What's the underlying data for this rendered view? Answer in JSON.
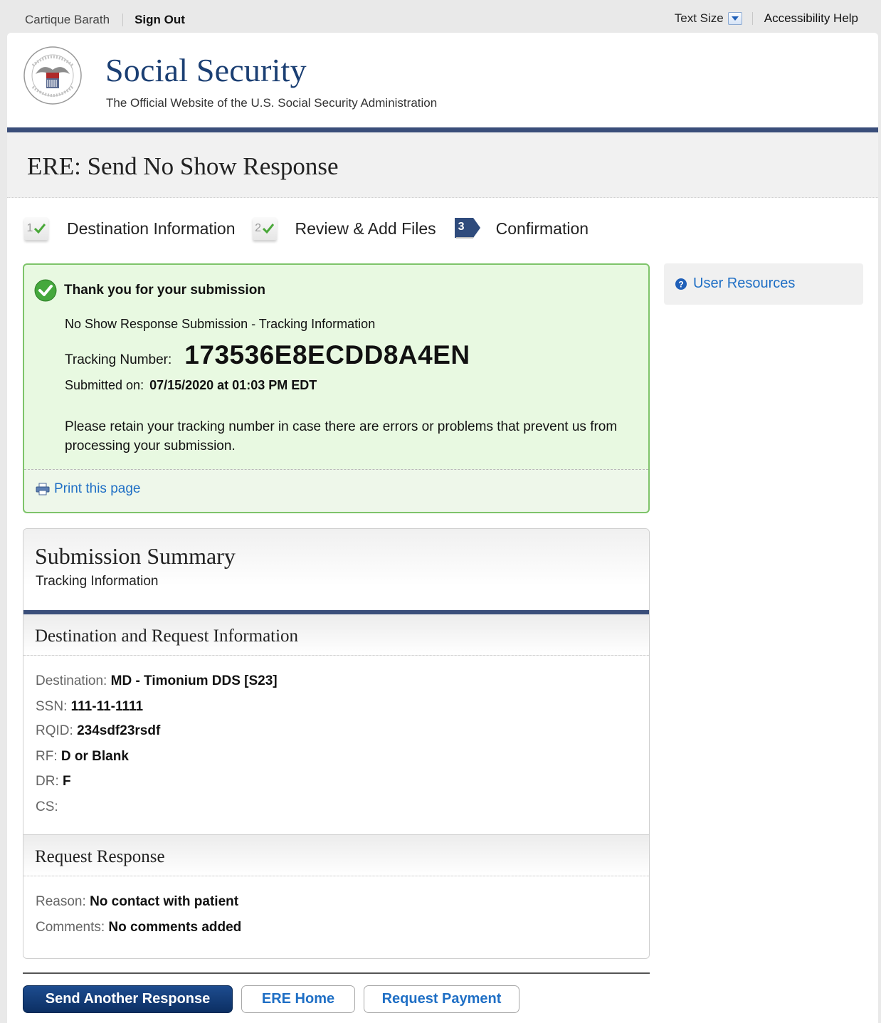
{
  "utility": {
    "user_name": "Cartique Barath",
    "sign_out": "Sign Out",
    "text_size": "Text Size",
    "accessibility_help": "Accessibility Help"
  },
  "header": {
    "title": "Social Security",
    "subtitle": "The Official Website of the U.S. Social Security Administration"
  },
  "page_title": "ERE: Send No Show Response",
  "steps": [
    {
      "num": "1",
      "label": "Destination Information",
      "state": "complete"
    },
    {
      "num": "2",
      "label": "Review & Add Files",
      "state": "complete"
    },
    {
      "num": "3",
      "label": "Confirmation",
      "state": "current"
    }
  ],
  "confirmation": {
    "title": "Thank you for your submission",
    "tracking_heading": "No Show Response Submission - Tracking Information",
    "tracking_label": "Tracking Number:",
    "tracking_number": "173536E8ECDD8A4EN",
    "submitted_label": "Submitted on:",
    "submitted_value": "07/15/2020 at 01:03 PM EDT",
    "message": "Please retain your tracking number in case there are errors or problems that prevent us from processing your submission.",
    "print_link": "Print this page"
  },
  "side": {
    "user_resources": "User Resources"
  },
  "summary": {
    "title": "Submission Summary",
    "subtitle": "Tracking Information",
    "destination_section": {
      "title": "Destination and Request Information",
      "fields": [
        {
          "label": "Destination:",
          "value": "MD - Timonium DDS [S23]"
        },
        {
          "label": "SSN:",
          "value": "111-11-1111"
        },
        {
          "label": "RQID:",
          "value": "234sdf23rsdf"
        },
        {
          "label": "RF:",
          "value": "D or Blank"
        },
        {
          "label": "DR:",
          "value": "F"
        },
        {
          "label": "CS:",
          "value": ""
        }
      ]
    },
    "response_section": {
      "title": "Request Response",
      "fields": [
        {
          "label": "Reason:",
          "value": "No contact with patient"
        },
        {
          "label": "Comments:",
          "value": "No comments added"
        }
      ]
    }
  },
  "actions": {
    "send_another": "Send Another Response",
    "ere_home": "ERE Home",
    "request_payment": "Request Payment"
  },
  "colors": {
    "brand_navy": "#3a4e7a",
    "link_blue": "#1f6fc5",
    "success_bg": "#e8f9e1",
    "success_border": "#7ec46a",
    "primary_button": "#0c2f63"
  }
}
